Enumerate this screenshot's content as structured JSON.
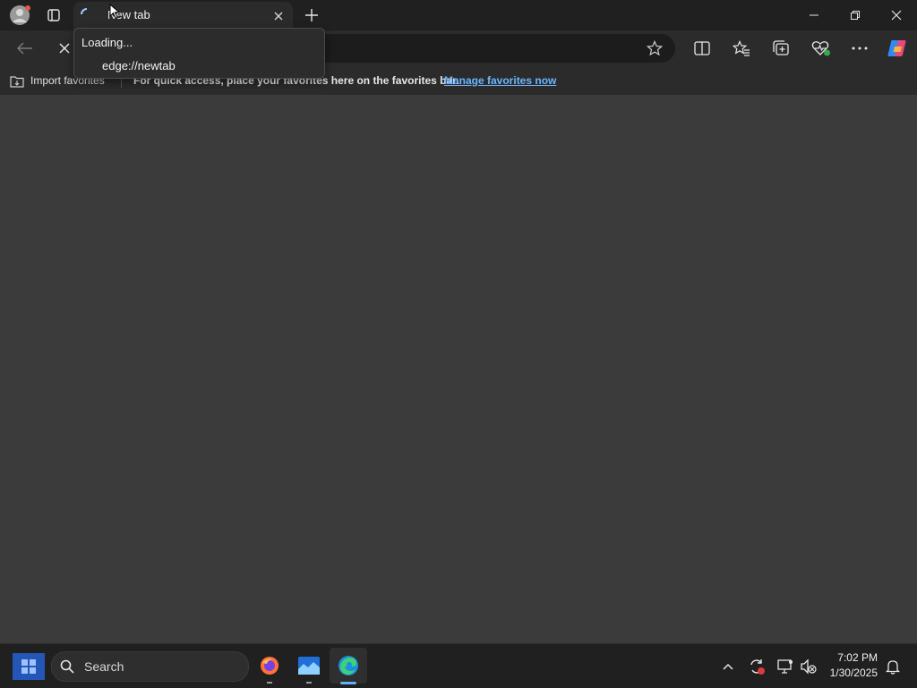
{
  "browser": {
    "tab": {
      "title": "New tab",
      "tooltip_status": "Loading...",
      "tooltip_url": "edge://newtab"
    },
    "favorites_bar": {
      "import_label": "Import favorites",
      "hint_text": "For quick access, place your favorites here on the favorites bar.",
      "manage_link": "Manage favorites now"
    }
  },
  "taskbar": {
    "search_label": "Search",
    "time": "7:02 PM",
    "date": "1/30/2025"
  },
  "colors": {
    "accent_link": "#6cb6ff",
    "content_bg": "#3b3b3b"
  }
}
